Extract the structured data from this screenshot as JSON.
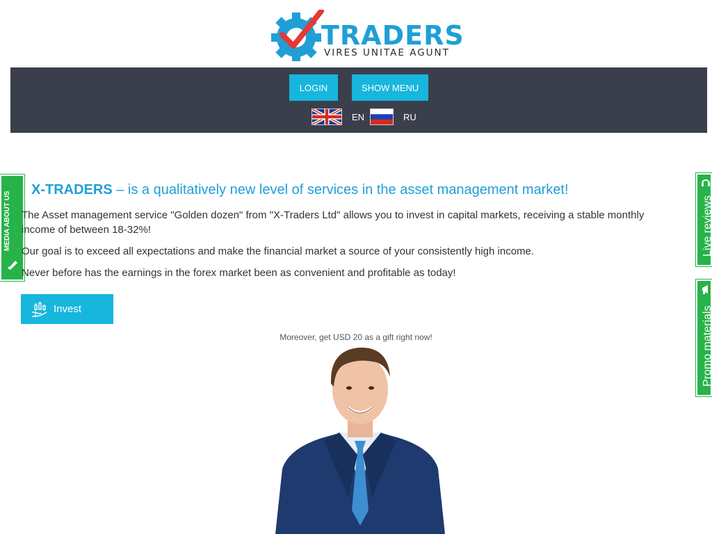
{
  "brand": {
    "name": "TRADERS",
    "tagline": "VIRES UNITAE AGUNT",
    "accent_color": "#1f9fd6",
    "logo_icon": "gear-check-icon"
  },
  "topbar": {
    "background": "#3a3f4b",
    "login_label": "LOGIN",
    "menu_label": "SHOW MENU",
    "languages": [
      {
        "code": "EN",
        "flag": "uk-flag-icon"
      },
      {
        "code": "RU",
        "flag": "russia-flag-icon"
      }
    ]
  },
  "side_tabs": {
    "media": {
      "label": "MEDIA ABOUT US",
      "icon": "pen-icon"
    },
    "reviews": {
      "label": "Live reviews",
      "icon": "headset-icon"
    },
    "promo": {
      "label": "Promo materials",
      "icon": "megaphone-icon"
    },
    "color": "#28b24a"
  },
  "main": {
    "headline_brand": "X-TRADERS",
    "headline_rest": " – is a qualitatively new level of services in the asset management market!",
    "paragraphs": [
      "The Asset management service \"Golden dozen\" from \"X-Traders Ltd\" allows you to invest in capital markets, receiving a stable monthly income of between 18-32%!",
      "Our goal is to exceed all expectations and make the financial market a source of your consistently high income.",
      "Never before has the earnings in the forex market been as convenient and profitable as today!"
    ],
    "invest_label": "Invest",
    "invest_icon": "invest-hand-chart-icon",
    "gift_text": "Moreover, get USD 20 as a gift right now!",
    "person_image": "businessman-photo"
  }
}
